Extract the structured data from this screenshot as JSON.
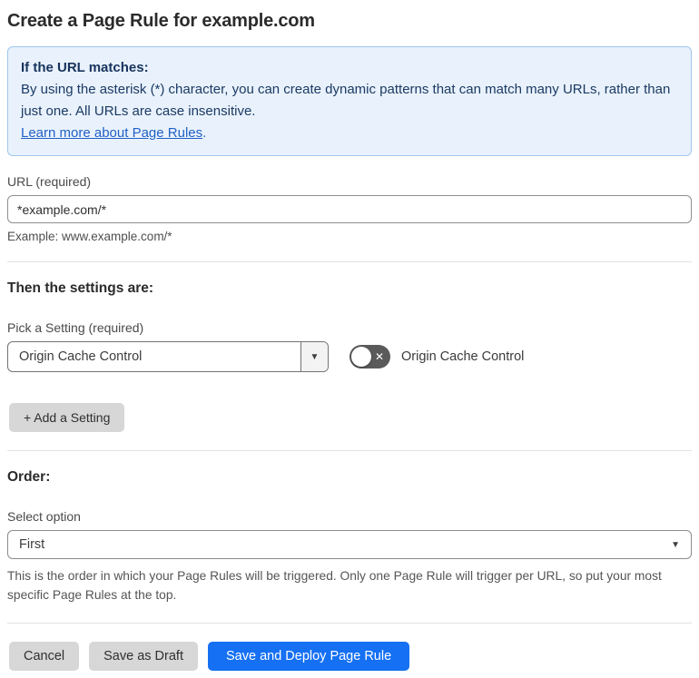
{
  "page": {
    "title": "Create a Page Rule for example.com"
  },
  "info_box": {
    "heading": "If the URL matches:",
    "body": "By using the asterisk (*) character, you can create dynamic patterns that can match many URLs, rather than just one. All URLs are case insensitive.",
    "link": "Learn more about Page Rules",
    "link_suffix": "."
  },
  "url_field": {
    "label": "URL (required)",
    "value": "*example.com/*",
    "example": "Example: www.example.com/*"
  },
  "settings_section": {
    "heading": "Then the settings are:",
    "picker_label": "Pick a Setting (required)",
    "picker_value": "Origin Cache Control",
    "toggle_state": "off",
    "toggle_label": "Origin Cache Control",
    "add_button_label": "+ Add a Setting"
  },
  "order_section": {
    "heading": "Order:",
    "select_label": "Select option",
    "select_value": "First",
    "help": "This is the order in which your Page Rules will be triggered. Only one Page Rule will trigger per URL, so put your most specific Page Rules at the top."
  },
  "footer": {
    "cancel_label": "Cancel",
    "save_draft_label": "Save as Draft",
    "save_deploy_label": "Save and Deploy Page Rule"
  },
  "icons": {
    "caret_down": "▼",
    "toggle_x": "✕"
  },
  "colors": {
    "info_bg": "#e9f2fc",
    "info_border": "#9fc7ef",
    "info_text": "#1b3a64",
    "link_blue": "#2261c6",
    "primary_blue": "#1570f3",
    "toggle_off_bg": "#5a5a5a",
    "button_gray": "#d7d7d7"
  }
}
